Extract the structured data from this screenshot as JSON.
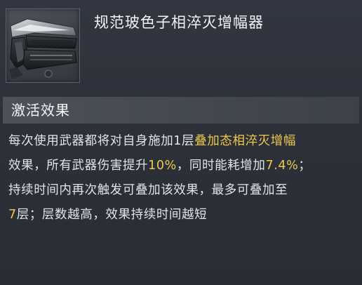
{
  "item": {
    "name": "规范玻色子相淬灭增幅器",
    "icon": "weapon-module-icon"
  },
  "section": {
    "title": "激活效果"
  },
  "effect": {
    "highlight_color": "#f0c84a",
    "lines": [
      {
        "parts": [
          {
            "text": "每次使用武器都将对自身施加1层",
            "highlight": false
          },
          {
            "text": "叠加态相淬灭增幅",
            "highlight": true
          }
        ]
      },
      {
        "parts": [
          {
            "text": "效果，所有武器伤害提升",
            "highlight": false
          },
          {
            "text": "10%",
            "highlight": true
          },
          {
            "text": "，同时能耗增加",
            "highlight": false
          },
          {
            "text": "7.4%",
            "highlight": true
          },
          {
            "text": "；",
            "highlight": false
          }
        ]
      },
      {
        "parts": [
          {
            "text": "持续时间内再次触发可叠加该效果，最多可叠加至",
            "highlight": false
          }
        ]
      },
      {
        "parts": [
          {
            "text": "7",
            "highlight": true
          },
          {
            "text": "层；层数越高，效果持续时间越短",
            "highlight": false
          }
        ]
      }
    ]
  }
}
